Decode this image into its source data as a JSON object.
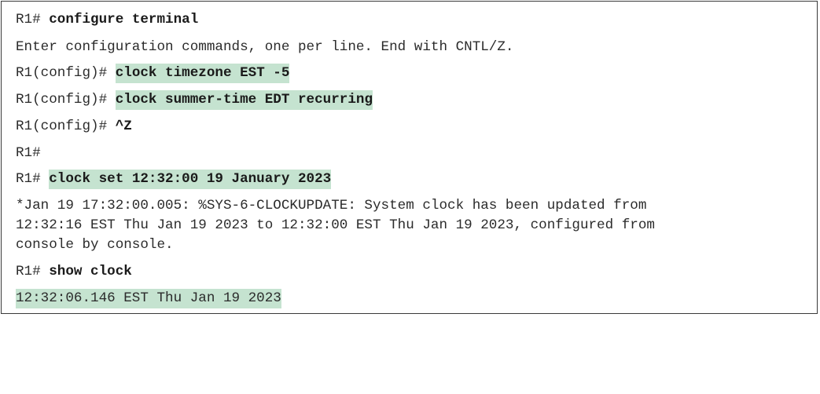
{
  "lines": [
    {
      "prompt": "R1# ",
      "command": "configure terminal"
    },
    {
      "output": "Enter configuration commands, one per line. End with CNTL/Z."
    },
    {
      "prompt": "R1(config)# ",
      "command": "clock timezone EST -5"
    },
    {
      "prompt": "R1(config)# ",
      "command": "clock summer-time EDT recurring"
    },
    {
      "prompt": "R1(config)# ",
      "command": "^Z"
    },
    {
      "prompt": "R1#"
    },
    {
      "prompt": "R1# ",
      "command": "clock set 12:32:00 19 January 2023"
    },
    {
      "output_lines": [
        "*Jan 19 17:32:00.005: %SYS-6-CLOCKUPDATE: System clock has been updated from",
        "12:32:16 EST Thu Jan 19 2023 to 12:32:00 EST Thu Jan 19 2023, configured from",
        "console by console."
      ]
    },
    {
      "prompt": "R1# ",
      "command": "show clock"
    },
    {
      "output": "12:32:06.146 EST Thu Jan 19 2023"
    }
  ],
  "colors": {
    "highlight": "#c5e3d0",
    "border": "#3a3a3a",
    "text": "#2b2b2b"
  }
}
